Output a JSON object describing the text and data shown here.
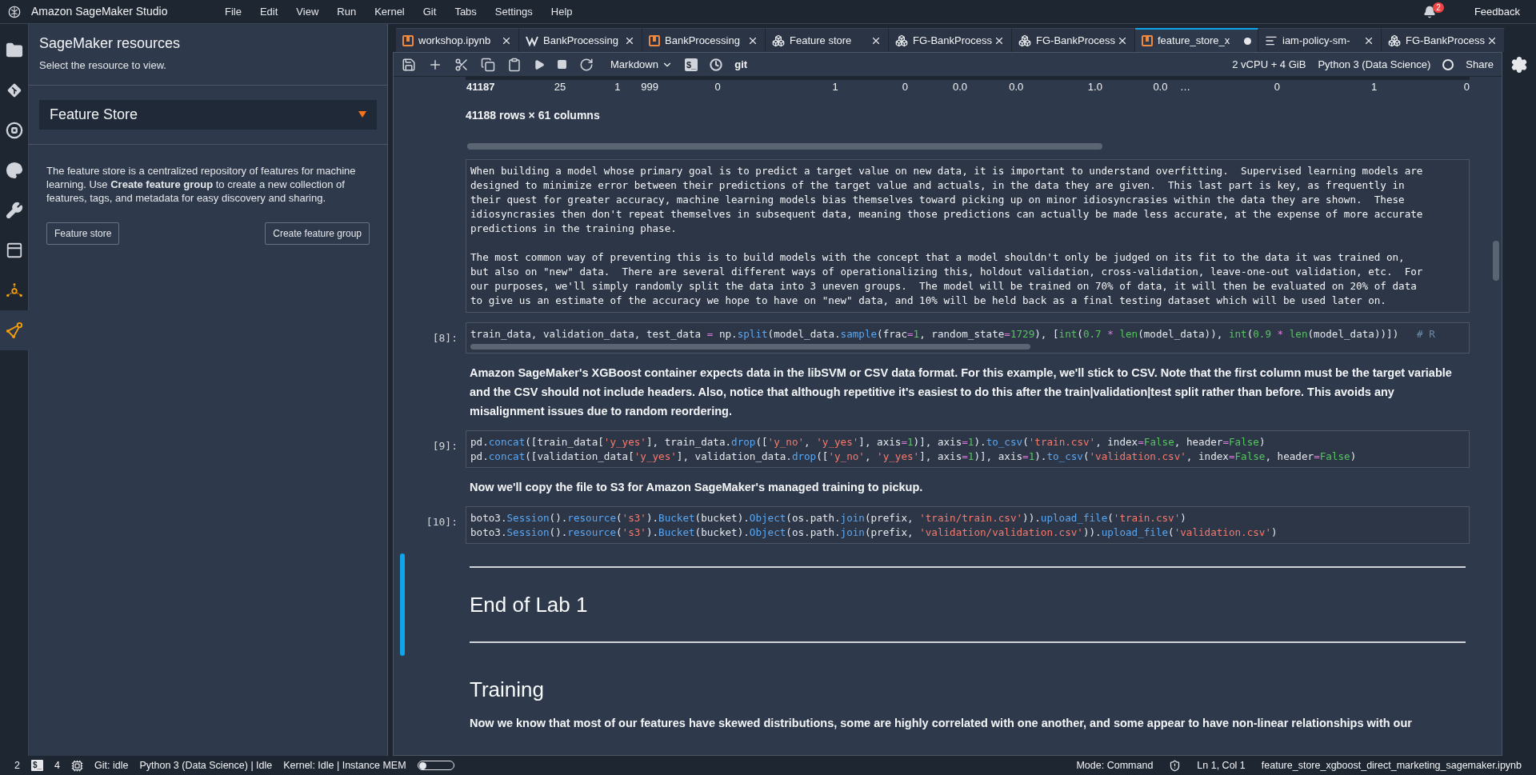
{
  "app": {
    "title": "Amazon SageMaker Studio"
  },
  "menu": [
    "File",
    "Edit",
    "View",
    "Run",
    "Kernel",
    "Git",
    "Tabs",
    "Settings",
    "Help"
  ],
  "notifications": {
    "count": "2"
  },
  "feedback": "Feedback",
  "activity_bar": [
    {
      "kind": "folder",
      "selected": false
    },
    {
      "kind": "git",
      "selected": false
    },
    {
      "kind": "stop",
      "selected": false
    },
    {
      "kind": "palette",
      "selected": false
    },
    {
      "kind": "wrench",
      "selected": false
    },
    {
      "kind": "window",
      "selected": false
    },
    {
      "kind": "network",
      "selected": false
    },
    {
      "kind": "nodes",
      "selected": true
    }
  ],
  "sidebar": {
    "title": "SageMaker resources",
    "subtitle": "Select the resource to view.",
    "dropdown": {
      "value": "Feature Store"
    },
    "description": "The feature store is a centralized repository of features for machine learning. Use **Create feature group** to create a new collection of features, tags, and metadata for easy discovery and sharing.",
    "buttons": [
      "Feature store",
      "Create feature group"
    ]
  },
  "tabs": [
    {
      "kind": "notebook",
      "label": "workshop.ipynb",
      "selected": false,
      "modified": false
    },
    {
      "kind": "flow",
      "label": "BankProcessing",
      "selected": false,
      "modified": false
    },
    {
      "kind": "notebook",
      "label": "BankProcessing",
      "selected": false,
      "modified": false
    },
    {
      "kind": "feature",
      "label": "Feature store",
      "selected": false,
      "modified": false
    },
    {
      "kind": "feature",
      "label": "FG-BankProcess",
      "selected": false,
      "modified": false
    },
    {
      "kind": "feature",
      "label": "FG-BankProcess",
      "selected": false,
      "modified": false
    },
    {
      "kind": "notebook",
      "label": "feature_store_x",
      "selected": true,
      "modified": true
    },
    {
      "kind": "text",
      "label": "iam-policy-sm-",
      "selected": false,
      "modified": false
    },
    {
      "kind": "feature",
      "label": "FG-BankProcess",
      "selected": false,
      "modified": false
    }
  ],
  "toolbar": {
    "cell_type": "Markdown",
    "terminal": "$_",
    "git": "git",
    "resources": "2 vCPU + 4 GiB",
    "kernel": "Python 3 (Data Science)",
    "kernel_busy": false,
    "share": "Share"
  },
  "notebook": {
    "table_row": [
      "41187",
      "25",
      "1",
      "999",
      "0",
      "1",
      "0",
      "0.0",
      "0.0",
      "1.0",
      "0.0",
      "…",
      "0",
      "1",
      "0"
    ],
    "table_summary": "41188 rows × 61 columns",
    "cells": [
      {
        "kind": "raw",
        "selected": false,
        "paragraphs": [
          "When building a model whose primary goal is to predict a target value on new data, it is important to understand overfitting.  Supervised learning models are\ndesigned to minimize error between their predictions of the target value and actuals, in the data they are given.  This last part is key, as frequently in\ntheir quest for greater accuracy, machine learning models bias themselves toward picking up on minor idiosyncrasies within the data they are shown.  These\nidiosyncrasies then don't repeat themselves in subsequent data, meaning those predictions can actually be made less accurate, at the expense of more accurate\npredictions in the training phase.",
          "The most common way of preventing this is to build models with the concept that a model shouldn't only be judged on its fit to the data it was trained on,\nbut also on \"new\" data.  There are several different ways of operationalizing this, holdout validation, cross-validation, leave-one-out validation, etc.  For\nour purposes, we'll simply randomly split the data into 3 uneven groups.  The model will be trained on 70% of data, it will then be evaluated on 20% of data\nto give us an estimate of the accuracy we hope to have on \"new\" data, and 10% will be held back as a final testing dataset which will be used later on."
        ]
      },
      {
        "kind": "code",
        "selected": false,
        "prompt": "[8]:",
        "scroll": true,
        "lines": [
          [
            {
              "text": "train_data, validation_data, test_data ",
              "kind": "plain"
            },
            {
              "text": "=",
              "kind": "op"
            },
            {
              "text": " np.",
              "kind": "plain"
            },
            {
              "text": "split",
              "kind": "func"
            },
            {
              "text": "(model_data.",
              "kind": "plain"
            },
            {
              "text": "sample",
              "kind": "func"
            },
            {
              "text": "(frac",
              "kind": "plain"
            },
            {
              "text": "=",
              "kind": "op"
            },
            {
              "text": "1",
              "kind": "num"
            },
            {
              "text": ", random_state",
              "kind": "plain"
            },
            {
              "text": "=",
              "kind": "op"
            },
            {
              "text": "1729",
              "kind": "num"
            },
            {
              "text": "), [",
              "kind": "plain"
            },
            {
              "text": "int",
              "kind": "builtin"
            },
            {
              "text": "(",
              "kind": "plain"
            },
            {
              "text": "0.7",
              "kind": "num"
            },
            {
              "text": " * ",
              "kind": "op"
            },
            {
              "text": "len",
              "kind": "builtin"
            },
            {
              "text": "(model_data)), ",
              "kind": "plain"
            },
            {
              "text": "int",
              "kind": "builtin"
            },
            {
              "text": "(",
              "kind": "plain"
            },
            {
              "text": "0.9",
              "kind": "num"
            },
            {
              "text": " * ",
              "kind": "op"
            },
            {
              "text": "len",
              "kind": "builtin"
            },
            {
              "text": "(model_data))])   ",
              "kind": "plain"
            },
            {
              "text": "# R",
              "kind": "comment"
            }
          ]
        ]
      },
      {
        "kind": "markdown",
        "selected": false,
        "blocks": [
          {
            "kind": "p",
            "text": "Amazon SageMaker's XGBoost container expects data in the libSVM or CSV data format. For this example, we'll stick to CSV. Note that the first column must be the target variable and the CSV should not include headers. Also, notice that although repetitive it's easiest to do this after the train|validation|test split rather than before. This avoids any misalignment issues due to random reordering."
          }
        ]
      },
      {
        "kind": "code",
        "selected": false,
        "prompt": "[9]:",
        "scroll": false,
        "lines": [
          [
            {
              "text": "pd.",
              "kind": "plain"
            },
            {
              "text": "concat",
              "kind": "func"
            },
            {
              "text": "([train_data[",
              "kind": "plain"
            },
            {
              "text": "'y_yes'",
              "kind": "str"
            },
            {
              "text": "], train_data.",
              "kind": "plain"
            },
            {
              "text": "drop",
              "kind": "func"
            },
            {
              "text": "([",
              "kind": "plain"
            },
            {
              "text": "'y_no'",
              "kind": "str"
            },
            {
              "text": ", ",
              "kind": "plain"
            },
            {
              "text": "'y_yes'",
              "kind": "str"
            },
            {
              "text": "], axis",
              "kind": "plain"
            },
            {
              "text": "=",
              "kind": "op"
            },
            {
              "text": "1",
              "kind": "num"
            },
            {
              "text": ")], axis",
              "kind": "plain"
            },
            {
              "text": "=",
              "kind": "op"
            },
            {
              "text": "1",
              "kind": "num"
            },
            {
              "text": ").",
              "kind": "plain"
            },
            {
              "text": "to_csv",
              "kind": "func"
            },
            {
              "text": "(",
              "kind": "plain"
            },
            {
              "text": "'train.csv'",
              "kind": "str"
            },
            {
              "text": ", index",
              "kind": "plain"
            },
            {
              "text": "=",
              "kind": "op"
            },
            {
              "text": "False",
              "kind": "num"
            },
            {
              "text": ", header",
              "kind": "plain"
            },
            {
              "text": "=",
              "kind": "op"
            },
            {
              "text": "False",
              "kind": "num"
            },
            {
              "text": ")",
              "kind": "plain"
            }
          ],
          [
            {
              "text": "pd.",
              "kind": "plain"
            },
            {
              "text": "concat",
              "kind": "func"
            },
            {
              "text": "([validation_data[",
              "kind": "plain"
            },
            {
              "text": "'y_yes'",
              "kind": "str"
            },
            {
              "text": "], validation_data.",
              "kind": "plain"
            },
            {
              "text": "drop",
              "kind": "func"
            },
            {
              "text": "([",
              "kind": "plain"
            },
            {
              "text": "'y_no'",
              "kind": "str"
            },
            {
              "text": ", ",
              "kind": "plain"
            },
            {
              "text": "'y_yes'",
              "kind": "str"
            },
            {
              "text": "], axis",
              "kind": "plain"
            },
            {
              "text": "=",
              "kind": "op"
            },
            {
              "text": "1",
              "kind": "num"
            },
            {
              "text": ")], axis",
              "kind": "plain"
            },
            {
              "text": "=",
              "kind": "op"
            },
            {
              "text": "1",
              "kind": "num"
            },
            {
              "text": ").",
              "kind": "plain"
            },
            {
              "text": "to_csv",
              "kind": "func"
            },
            {
              "text": "(",
              "kind": "plain"
            },
            {
              "text": "'validation.csv'",
              "kind": "str"
            },
            {
              "text": ", index",
              "kind": "plain"
            },
            {
              "text": "=",
              "kind": "op"
            },
            {
              "text": "False",
              "kind": "num"
            },
            {
              "text": ", header",
              "kind": "plain"
            },
            {
              "text": "=",
              "kind": "op"
            },
            {
              "text": "False",
              "kind": "num"
            },
            {
              "text": ")",
              "kind": "plain"
            }
          ]
        ]
      },
      {
        "kind": "markdown",
        "selected": false,
        "blocks": [
          {
            "kind": "p",
            "text": "Now we'll copy the file to S3 for Amazon SageMaker's managed training to pickup."
          }
        ]
      },
      {
        "kind": "code",
        "selected": false,
        "prompt": "[10]:",
        "scroll": false,
        "lines": [
          [
            {
              "text": "boto3.",
              "kind": "plain"
            },
            {
              "text": "Session",
              "kind": "func"
            },
            {
              "text": "().",
              "kind": "plain"
            },
            {
              "text": "resource",
              "kind": "func"
            },
            {
              "text": "(",
              "kind": "plain"
            },
            {
              "text": "'s3'",
              "kind": "str"
            },
            {
              "text": ").",
              "kind": "plain"
            },
            {
              "text": "Bucket",
              "kind": "func"
            },
            {
              "text": "(bucket).",
              "kind": "plain"
            },
            {
              "text": "Object",
              "kind": "func"
            },
            {
              "text": "(os.path.",
              "kind": "plain"
            },
            {
              "text": "join",
              "kind": "func"
            },
            {
              "text": "(prefix, ",
              "kind": "plain"
            },
            {
              "text": "'train/train.csv'",
              "kind": "str"
            },
            {
              "text": ")).",
              "kind": "plain"
            },
            {
              "text": "upload_file",
              "kind": "func"
            },
            {
              "text": "(",
              "kind": "plain"
            },
            {
              "text": "'train.csv'",
              "kind": "str"
            },
            {
              "text": ")",
              "kind": "plain"
            }
          ],
          [
            {
              "text": "boto3.",
              "kind": "plain"
            },
            {
              "text": "Session",
              "kind": "func"
            },
            {
              "text": "().",
              "kind": "plain"
            },
            {
              "text": "resource",
              "kind": "func"
            },
            {
              "text": "(",
              "kind": "plain"
            },
            {
              "text": "'s3'",
              "kind": "str"
            },
            {
              "text": ").",
              "kind": "plain"
            },
            {
              "text": "Bucket",
              "kind": "func"
            },
            {
              "text": "(bucket).",
              "kind": "plain"
            },
            {
              "text": "Object",
              "kind": "func"
            },
            {
              "text": "(os.path.",
              "kind": "plain"
            },
            {
              "text": "join",
              "kind": "func"
            },
            {
              "text": "(prefix, ",
              "kind": "plain"
            },
            {
              "text": "'validation/validation.csv'",
              "kind": "str"
            },
            {
              "text": ")).",
              "kind": "plain"
            },
            {
              "text": "upload_file",
              "kind": "func"
            },
            {
              "text": "(",
              "kind": "plain"
            },
            {
              "text": "'validation.csv'",
              "kind": "str"
            },
            {
              "text": ")",
              "kind": "plain"
            }
          ]
        ]
      },
      {
        "kind": "markdown",
        "selected": true,
        "blocks": [
          {
            "kind": "rule"
          },
          {
            "kind": "h1",
            "text": "End of Lab 1"
          },
          {
            "kind": "rule"
          }
        ]
      },
      {
        "kind": "markdown",
        "selected": false,
        "blocks": [
          {
            "kind": "h1",
            "text": "Training"
          },
          {
            "kind": "p",
            "text": "Now we know that most of our features have skewed distributions, some are highly correlated with one another, and some appear to have non-linear relationships with our"
          }
        ]
      }
    ]
  },
  "status_bar": {
    "left": [
      {
        "kind": "text",
        "text": "2"
      },
      {
        "kind": "glyph",
        "text": "$_"
      },
      {
        "kind": "text",
        "text": "4"
      },
      {
        "kind": "cpu"
      },
      {
        "kind": "text",
        "text": "Git: idle"
      },
      {
        "kind": "text",
        "text": "Python 3 (Data Science) | Idle"
      },
      {
        "kind": "text",
        "text": "Kernel: Idle | Instance MEM"
      },
      {
        "kind": "memory"
      }
    ],
    "right": [
      {
        "kind": "text",
        "text": "Mode: Command"
      },
      {
        "kind": "shield"
      },
      {
        "kind": "text",
        "text": "Ln 1, Col 1"
      },
      {
        "kind": "text",
        "text": "feature_store_xgboost_direct_marketing_sagemaker.ipynb"
      }
    ]
  }
}
